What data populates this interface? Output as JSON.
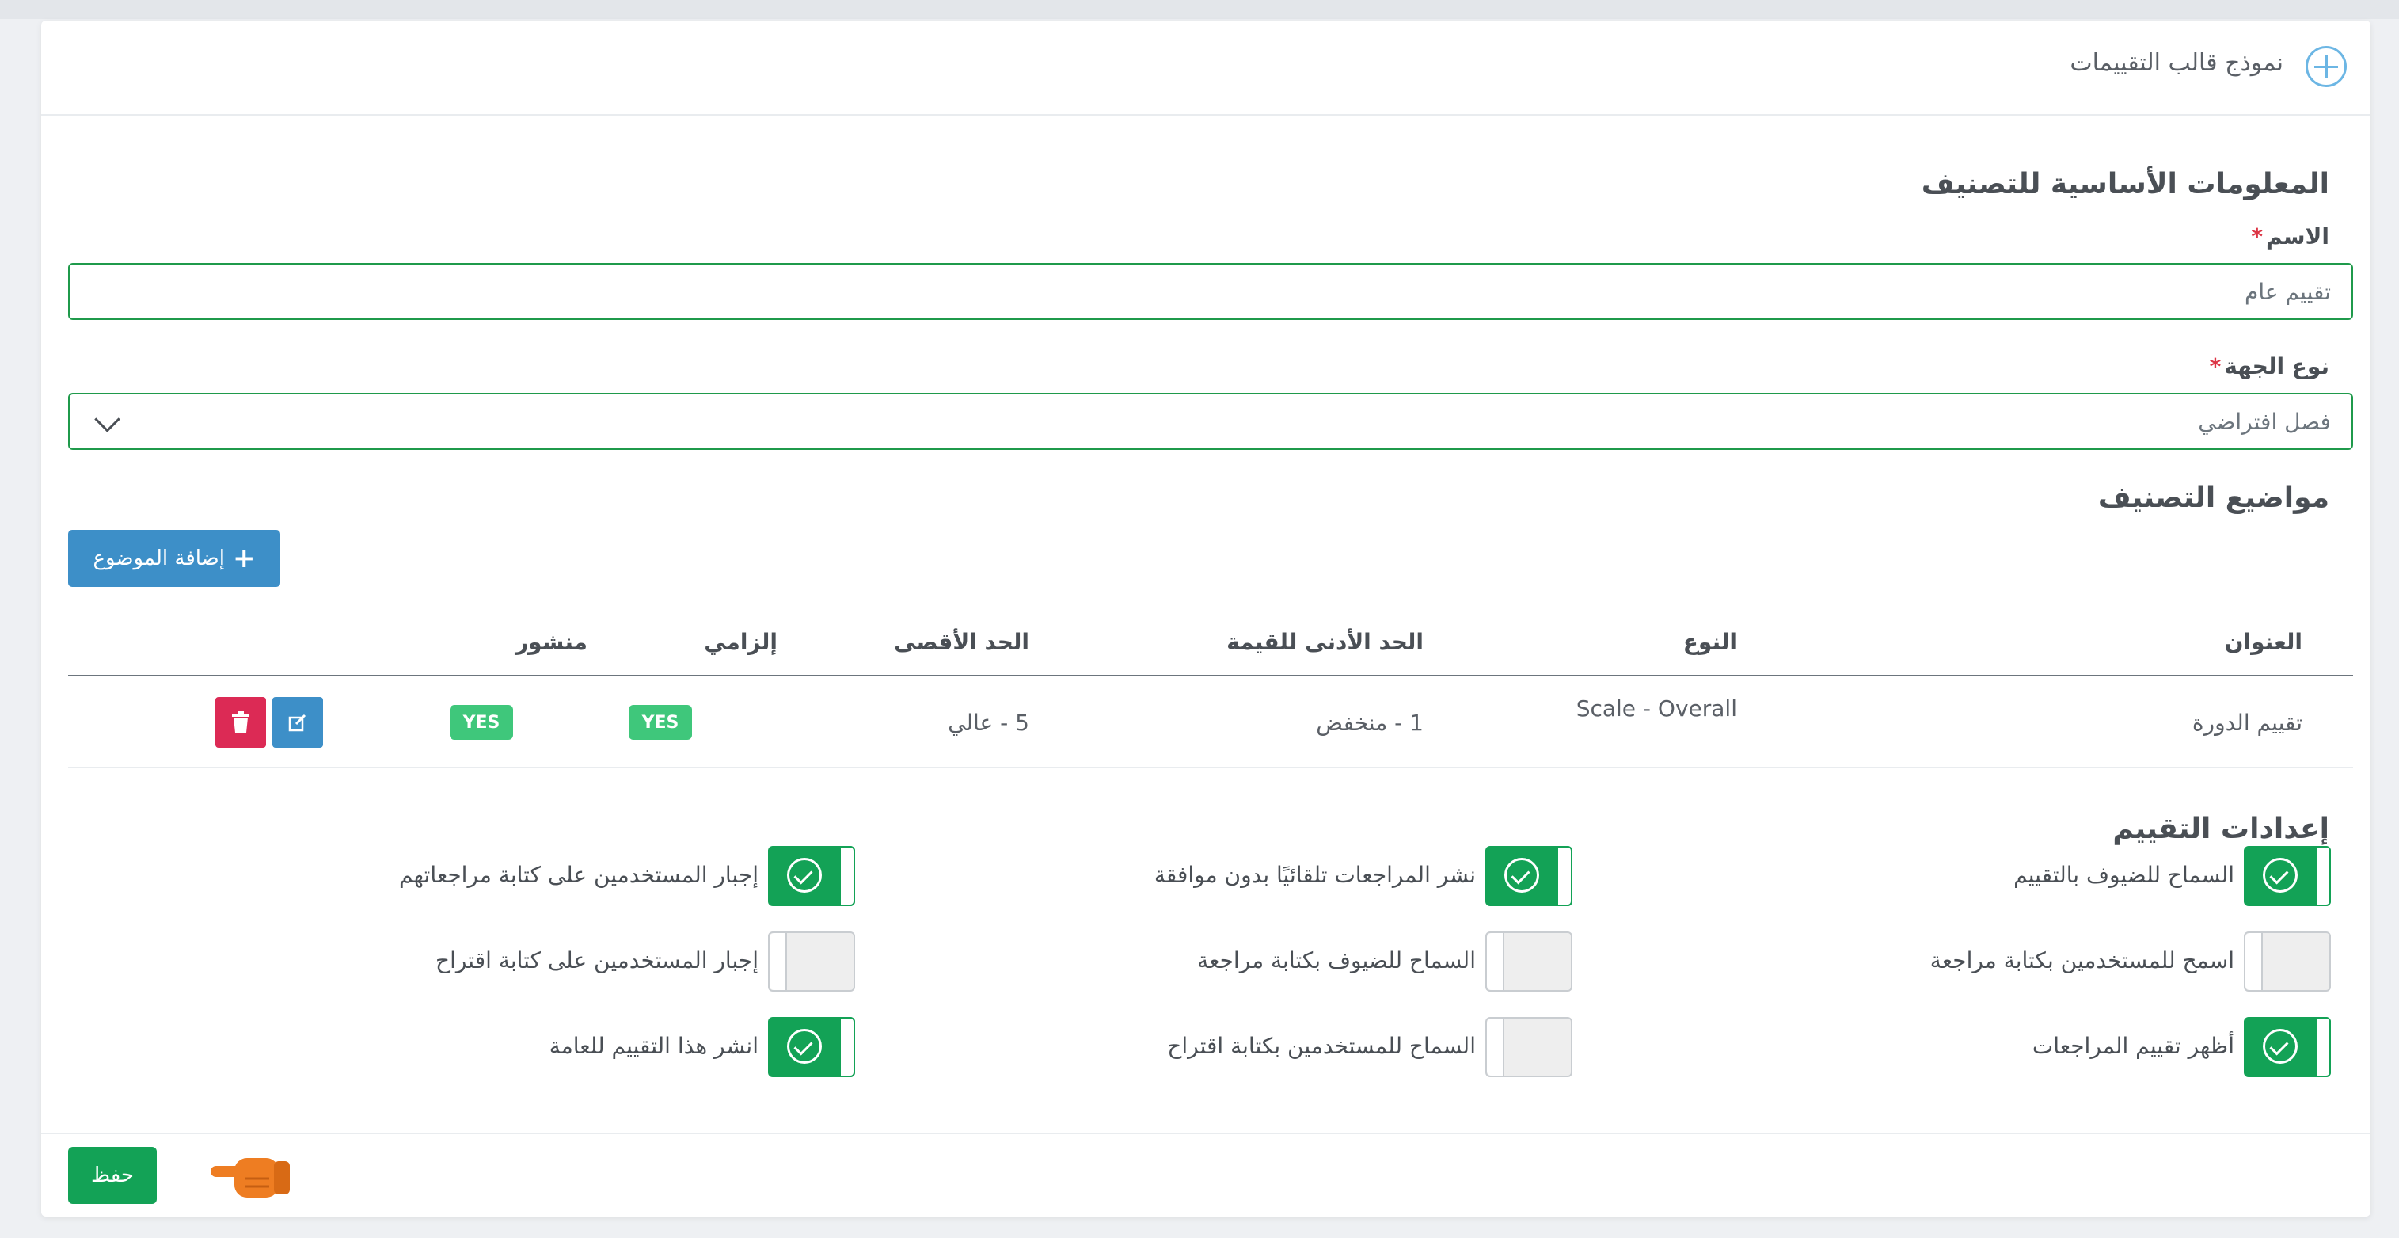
{
  "header": {
    "title": "نموذج قالب التقييمات"
  },
  "basic_info": {
    "section_title": "المعلومات الأساسية للتصنيف",
    "name_label": "الاسم",
    "name_value": "تقييم عام",
    "entity_type_label": "نوع الجهة",
    "entity_type_value": "فصل افتراضي",
    "required_mark": "*"
  },
  "topics": {
    "section_title": "مواضيع التصنيف",
    "add_button_label": "إضافة الموضوع",
    "columns": {
      "title": "العنوان",
      "type": "النوع",
      "min": "الحد الأدنى للقيمة",
      "max": "الحد الأقصى",
      "required": "إلزامي",
      "published": "منشور"
    },
    "rows": [
      {
        "title": "تقييم الدورة",
        "type": "Scale - Overall",
        "min": "1 - منخفض",
        "max": "5 - عالي",
        "required": "YES",
        "published": "YES"
      }
    ]
  },
  "settings": {
    "section_title": "إعدادات التقييم",
    "items": [
      {
        "label": "السماح للضيوف بالتقييم",
        "on": true
      },
      {
        "label": "نشر المراجعات تلقائيًا بدون موافقة",
        "on": true
      },
      {
        "label": "إجبار المستخدمين على كتابة مراجعاتهم",
        "on": true
      },
      {
        "label": "اسمح للمستخدمين بكتابة مراجعة",
        "on": false
      },
      {
        "label": "السماح للضيوف بكتابة مراجعة",
        "on": false
      },
      {
        "label": "إجبار المستخدمين على كتابة اقتراح",
        "on": false
      },
      {
        "label": "أظهر تقييم المراجعات",
        "on": true
      },
      {
        "label": "السماح للمستخدمين بكتابة اقتراح",
        "on": false
      },
      {
        "label": "انشر هذا التقييم للعامة",
        "on": true
      }
    ]
  },
  "footer": {
    "save_label": "حفظ"
  },
  "colors": {
    "primary_green": "#13a256",
    "primary_blue": "#3d8fc8",
    "danger": "#dc2a55",
    "badge_green": "#3fc77b"
  },
  "icons": {
    "header": "plus-circle-icon",
    "edit": "edit-icon",
    "delete": "trash-icon",
    "pointer": "pointing-hand-icon"
  }
}
